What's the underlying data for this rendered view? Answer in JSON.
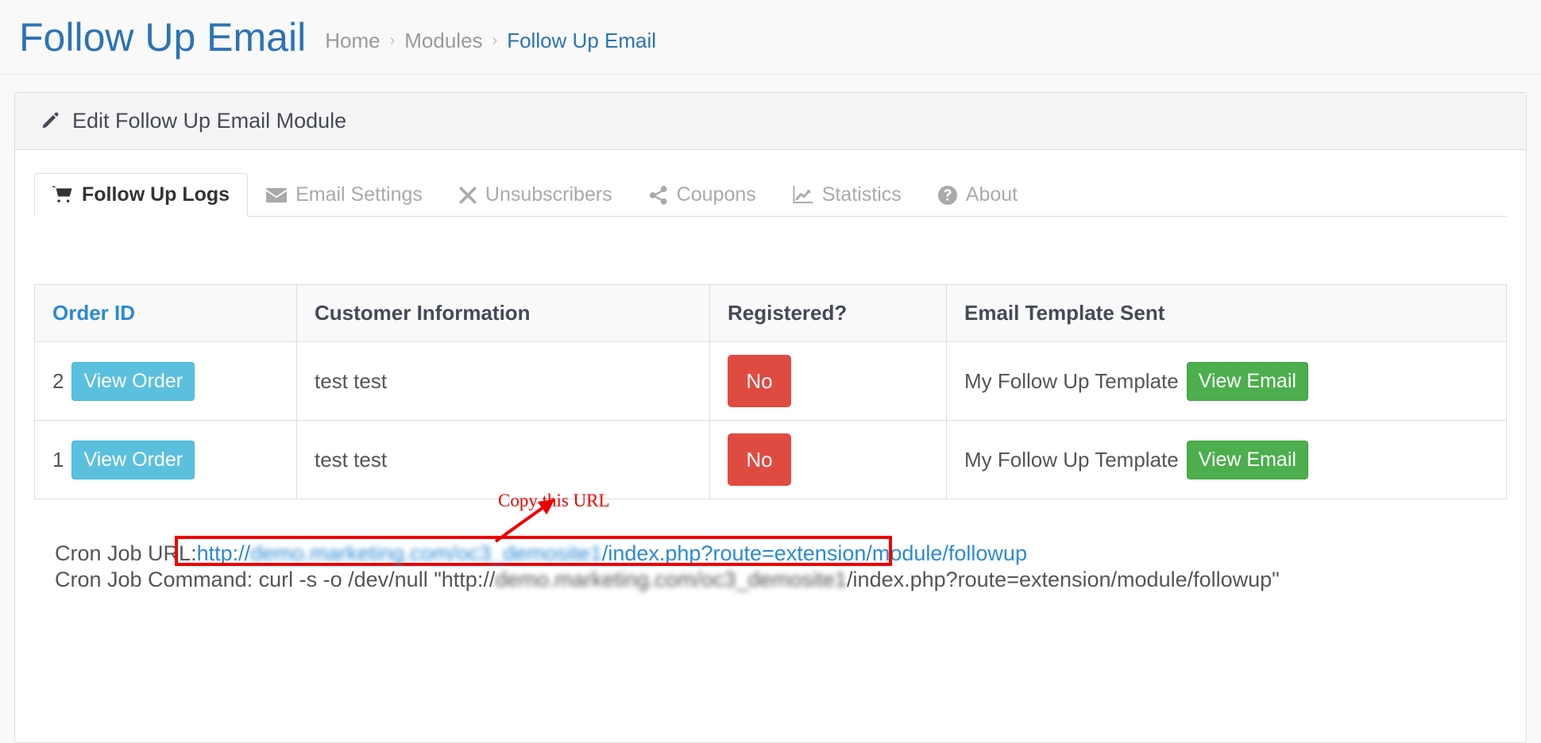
{
  "header": {
    "title": "Follow Up Email",
    "breadcrumb": [
      {
        "label": "Home",
        "active": false
      },
      {
        "label": "Modules",
        "active": false
      },
      {
        "label": "Follow Up Email",
        "active": true
      }
    ],
    "breadcrumb_separator": "›"
  },
  "panel": {
    "heading": "Edit Follow Up Email Module",
    "heading_icon": "pencil-icon"
  },
  "tabs": [
    {
      "label": "Follow Up Logs",
      "icon": "shopping-cart-icon",
      "active": true
    },
    {
      "label": "Email Settings",
      "icon": "envelope-icon",
      "active": false
    },
    {
      "label": "Unsubscribers",
      "icon": "times-icon",
      "active": false
    },
    {
      "label": "Coupons",
      "icon": "share-alt-icon",
      "active": false
    },
    {
      "label": "Statistics",
      "icon": "line-chart-icon",
      "active": false
    },
    {
      "label": "About",
      "icon": "question-circle-icon",
      "active": false
    }
  ],
  "table": {
    "headers": [
      {
        "label": "Order ID",
        "sortable": true
      },
      {
        "label": "Customer Information",
        "sortable": false
      },
      {
        "label": "Registered?",
        "sortable": false
      },
      {
        "label": "Email Template Sent",
        "sortable": false
      }
    ],
    "rows": [
      {
        "order_id": "2",
        "view_order_label": "View Order",
        "customer": "test test",
        "registered": "No",
        "template": "My Follow Up Template",
        "view_email_label": "View Email"
      },
      {
        "order_id": "1",
        "view_order_label": "View Order",
        "customer": "test test",
        "registered": "No",
        "template": "My Follow Up Template",
        "view_email_label": "View Email"
      }
    ]
  },
  "cron": {
    "url_label": "Cron Job URL:",
    "url_scheme": "http://",
    "url_domain_redacted": "demo.marketing.com/oc3_demosite1",
    "url_path": "/index.php?route=extension/module/followup",
    "command_label": "Cron Job Command:",
    "command_prefix": "curl -s -o /dev/null \"http://",
    "command_domain_redacted": "demo.marketing.com/oc3_demosite1",
    "command_path": "/index.php?route=extension/module/followup\""
  },
  "annotation": {
    "text": "Copy this URL",
    "color": "#ee0000"
  },
  "colors": {
    "title_blue": "#2b73b5",
    "link_blue": "#2b8ad4",
    "info_button": "#5bc0de",
    "success_button": "#4cae4c",
    "danger_badge": "#e04b41",
    "annotation_red": "#ee0000"
  }
}
